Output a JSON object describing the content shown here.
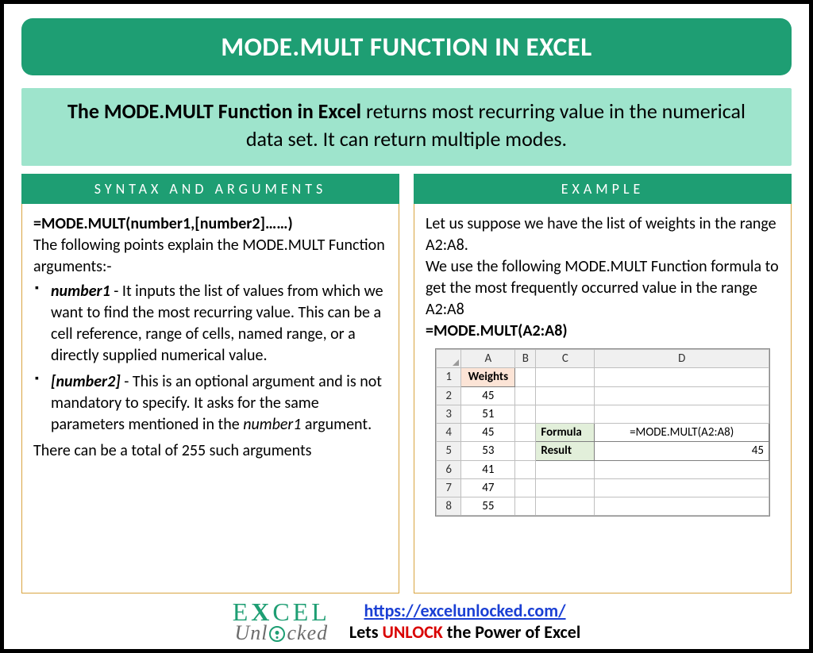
{
  "title": "MODE.MULT FUNCTION IN EXCEL",
  "description": {
    "bold_lead": "The MODE.MULT Function in Excel",
    "rest": " returns most recurring value in the numerical data set. It can return multiple modes."
  },
  "syntax": {
    "label": "SYNTAX AND ARGUMENTS",
    "formula": "=MODE.MULT(number1,[number2]……)",
    "intro": "The following points explain the MODE.MULT Function arguments:-",
    "args": [
      {
        "name": "number1",
        "text": " - It inputs the list of values from which we want to find the most recurring value. This can be a cell reference, range of cells, named range, or a directly supplied numerical value."
      },
      {
        "name": "[number2]",
        "text": " - This is an optional argument and is not mandatory to specify. It asks for the same parameters mentioned in the ",
        "tail_italic": "number1",
        "tail_after": " argument."
      }
    ],
    "footer": "There can be a total of 255 such arguments"
  },
  "example": {
    "label": "EXAMPLE",
    "p1": "Let us suppose we have the list of weights in the range A2:A8.",
    "p2": "We use the following MODE.MULT Function formula to get the most frequently occurred value in the range A2:A8",
    "formula": "=MODE.MULT(A2:A8)",
    "sheet": {
      "cols": [
        "A",
        "B",
        "C",
        "D"
      ],
      "header_a": "Weights",
      "rows_a": [
        "45",
        "51",
        "45",
        "53",
        "41",
        "47",
        "55"
      ],
      "formula_label": "Formula",
      "formula_value": "=MODE.MULT(A2:A8)",
      "result_label": "Result",
      "result_value": "45"
    }
  },
  "footer": {
    "logo_line1_pre": "E",
    "logo_line1_x": "X",
    "logo_line1_post": "CEL",
    "logo_line2_pre": "Unl",
    "logo_line2_post": "cked",
    "url": "https://excelunlocked.com/",
    "tagline_pre": "Lets ",
    "tagline_unlock": "UNLOCK",
    "tagline_post": " the Power of Excel"
  }
}
